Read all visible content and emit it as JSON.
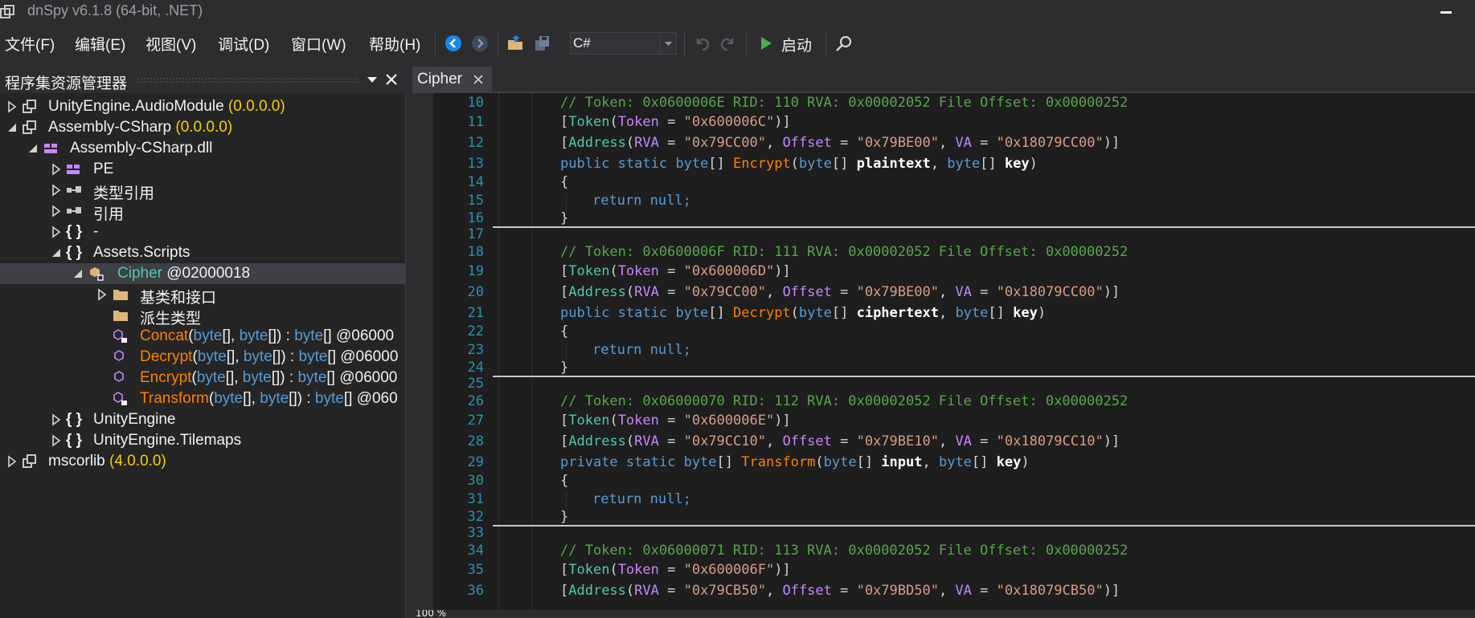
{
  "window": {
    "title": "dnSpy v6.1.8 (64-bit, .NET)"
  },
  "menu": [
    {
      "label": "文件(F)"
    },
    {
      "label": "编辑(E)"
    },
    {
      "label": "视图(V)"
    },
    {
      "label": "调试(D)"
    },
    {
      "label": "窗口(W)"
    },
    {
      "label": "帮助(H)"
    }
  ],
  "toolbar": {
    "language": "C#",
    "run_label": "启动",
    "icons": [
      "back-arrow-icon",
      "forward-arrow-icon",
      "open-folder-icon",
      "save-all-icon",
      "undo-icon",
      "redo-icon",
      "play-icon",
      "search-icon"
    ]
  },
  "assembly_explorer": {
    "title": "程序集资源管理器",
    "nodes": [
      {
        "label": "UnityEngine.AudioModule",
        "suffix": " (0.0.0.0)"
      },
      {
        "label": "Assembly-CSharp",
        "suffix": " (0.0.0.0)"
      },
      {
        "label": "Assembly-CSharp.dll"
      },
      {
        "label": "PE"
      },
      {
        "label": "类型引用"
      },
      {
        "label": "引用"
      },
      {
        "label": "-"
      },
      {
        "label": "Assets.Scripts"
      },
      {
        "label": "Cipher",
        "suffix": " @02000018"
      },
      {
        "label": "基类和接口"
      },
      {
        "label": "派生类型"
      },
      {
        "name": "Concat",
        "params": [
          "byte",
          "[], ",
          "byte",
          "[]) : ",
          "byte",
          "[] @06000"
        ]
      },
      {
        "name": "Decrypt",
        "params": [
          "byte",
          "[], ",
          "byte",
          "[]) : ",
          "byte",
          "[] @06000"
        ]
      },
      {
        "name": "Encrypt",
        "params": [
          "byte",
          "[], ",
          "byte",
          "[]) : ",
          "byte",
          "[] @06000"
        ]
      },
      {
        "name": "Transform",
        "params": [
          "byte",
          "[], ",
          "byte",
          "[]) : ",
          "byte",
          "[] @060"
        ]
      },
      {
        "label": "UnityEngine"
      },
      {
        "label": "UnityEngine.Tilemaps"
      },
      {
        "label": "mscorlib",
        "suffix": " (4.0.0.0)"
      }
    ]
  },
  "tab": {
    "label": "Cipher"
  },
  "code": {
    "line_numbers": [
      "10",
      "11",
      "12",
      "13",
      "14",
      "15",
      "16",
      "17",
      "18",
      "19",
      "20",
      "21",
      "22",
      "23",
      "24",
      "25",
      "26",
      "27",
      "28",
      "29",
      "30",
      "31",
      "32",
      "33",
      "34",
      "35",
      "36"
    ],
    "blocks": [
      {
        "comment": "// Token: 0x0600006E RID: 110 RVA: 0x00002052 File Offset: 0x00000252",
        "token": "\"0x600006C\"",
        "rva": "\"0x79CC00\"",
        "offset": "\"0x79BE00\"",
        "va": "\"0x18079CC00\"",
        "access": "public",
        "method": "Encrypt",
        "param1": "plaintext",
        "param2": "key"
      },
      {
        "comment": "// Token: 0x0600006F RID: 111 RVA: 0x00002052 File Offset: 0x00000252",
        "token": "\"0x600006D\"",
        "rva": "\"0x79CC00\"",
        "offset": "\"0x79BE00\"",
        "va": "\"0x18079CC00\"",
        "access": "public",
        "method": "Decrypt",
        "param1": "ciphertext",
        "param2": "key"
      },
      {
        "comment": "// Token: 0x06000070 RID: 112 RVA: 0x00002052 File Offset: 0x00000252",
        "token": "\"0x600006E\"",
        "rva": "\"0x79CC10\"",
        "offset": "\"0x79BE10\"",
        "va": "\"0x18079CC10\"",
        "access": "private",
        "method": "Transform",
        "param1": "input",
        "param2": "key"
      },
      {
        "comment": "// Token: 0x06000071 RID: 113 RVA: 0x00002052 File Offset: 0x00000252",
        "token": "\"0x600006F\"",
        "rva": "\"0x79CB50\"",
        "offset": "\"0x79BD50\"",
        "va": "\"0x18079CB50\""
      }
    ],
    "kw": {
      "token_attr": "Token",
      "address_attr": "Address",
      "rva": "RVA",
      "offset": "Offset",
      "va": "VA",
      "static": "static",
      "byte": "byte",
      "return_null": "return null;",
      "open": "{",
      "close": "}"
    }
  },
  "status": {
    "zoom": "100 %"
  },
  "colors": {
    "namespace": "#f5d000",
    "type": "#4ec9b0",
    "method": "#ff8000",
    "keyword": "#569cd6",
    "comment": "#57a64a",
    "string": "#d69d85",
    "assembly_dll": "#c586ff"
  }
}
